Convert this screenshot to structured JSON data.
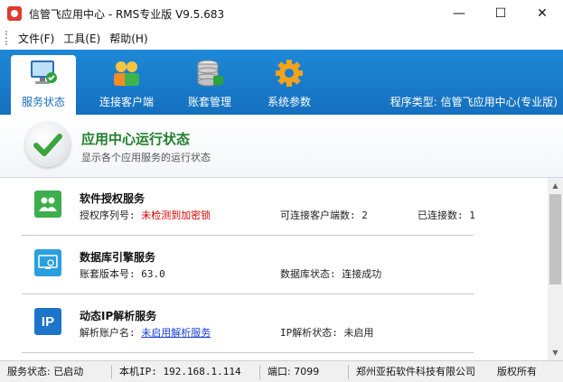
{
  "window": {
    "title": "信管飞应用中心 - RMS专业版 V9.5.683",
    "minimize": "—",
    "maximize": "☐",
    "close": "✕"
  },
  "menu": {
    "file": "文件(F)",
    "tools": "工具(E)",
    "help": "帮助(H)"
  },
  "tabs": [
    {
      "label": "服务状态",
      "icon": "monitor-check-icon"
    },
    {
      "label": "连接客户端",
      "icon": "users-icon"
    },
    {
      "label": "账套管理",
      "icon": "database-icon"
    },
    {
      "label": "系统参数",
      "icon": "gear-icon"
    }
  ],
  "program_type": "程序类型: 信管飞应用中心(专业版)",
  "header": {
    "title": "应用中心运行状态",
    "subtitle": "显示各个应用服务的运行状态"
  },
  "services": [
    {
      "name": "软件授权服务",
      "serial_label": "授权序列号:",
      "serial_value": "未检测到加密锁",
      "clients_label": "可连接客户端数:",
      "clients_value": "2",
      "connected_label": "已连接数:",
      "connected_value": "1"
    },
    {
      "name": "数据库引擎服务",
      "version_label": "账套版本号:",
      "version_value": "63.0",
      "db_status_label": "数据库状态:",
      "db_status_value": "连接成功"
    },
    {
      "name": "动态IP解析服务",
      "account_label": "解析账户名:",
      "account_value": "未启用解析服务",
      "ip_status_label": "IP解析状态:",
      "ip_status_value": "未启用"
    }
  ],
  "status_bar": {
    "service_status": "服务状态: 已启动",
    "local_ip": "本机IP: 192.168.1.114",
    "port": "端口: 7099",
    "company": "郑州亚拓软件科技有限公司",
    "copyright": "版权所有"
  },
  "colors": {
    "toolbar_blue": "#1a7dcf",
    "header_green": "#1f7f2a",
    "error_red": "#d60000",
    "link_blue": "#1a3fd6"
  }
}
